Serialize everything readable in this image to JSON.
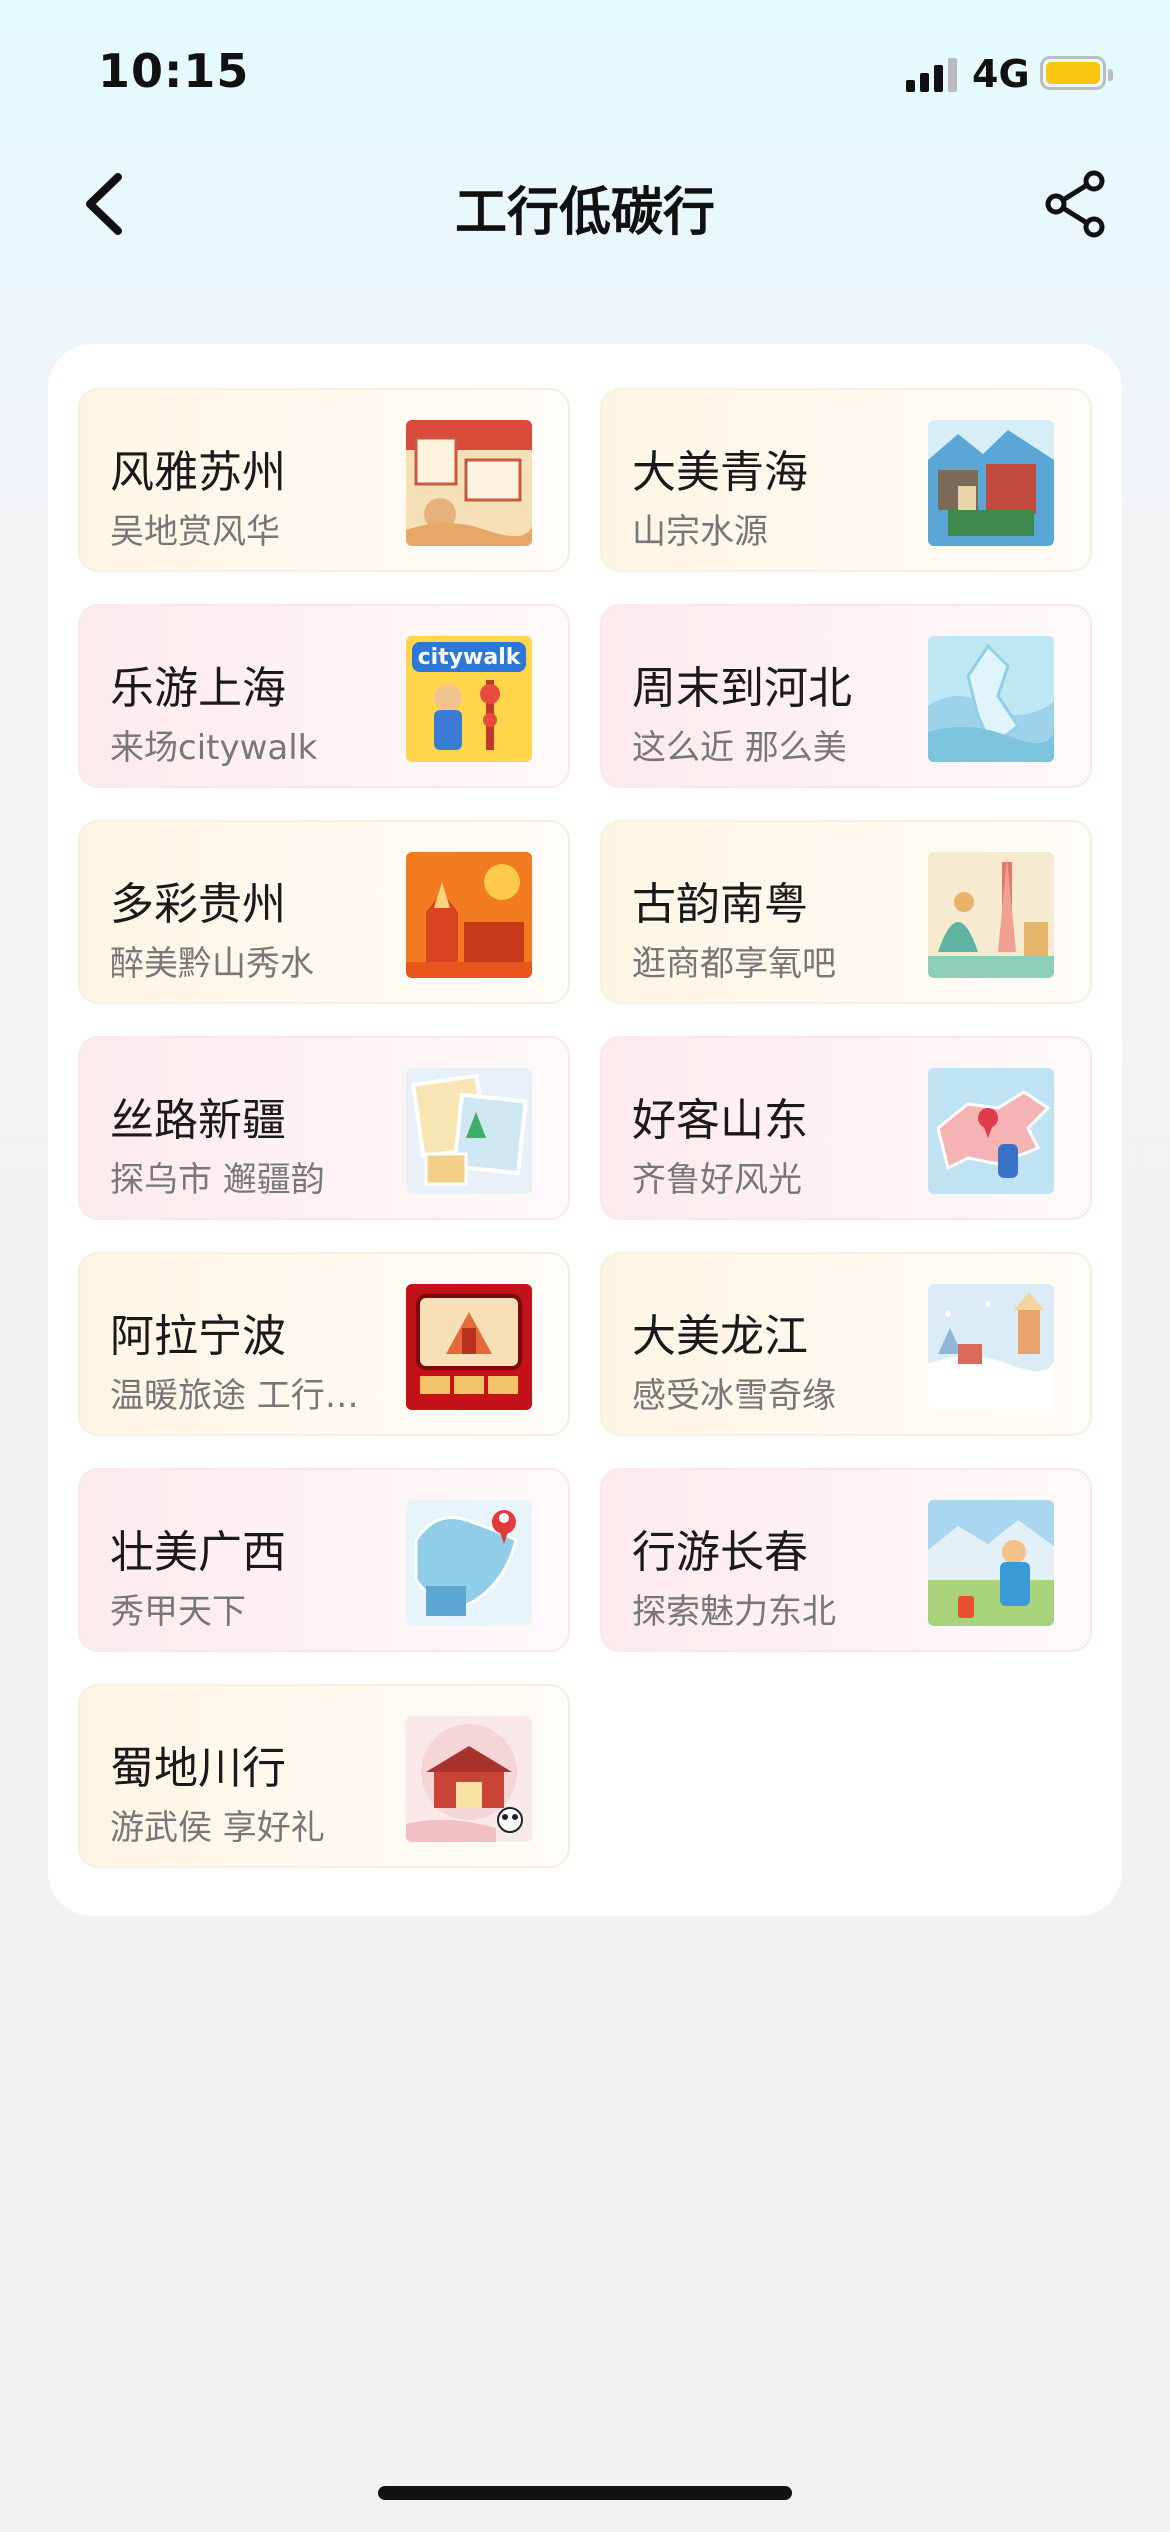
{
  "status": {
    "time": "10:15",
    "network": "4G"
  },
  "nav": {
    "title": "工行低碳行"
  },
  "tiles": [
    {
      "title": "风雅苏州",
      "subtitle": "吴地赏风华",
      "style": "warm",
      "thumb": "suzhou",
      "icon": "suzhou-thumbnail"
    },
    {
      "title": "大美青海",
      "subtitle": "山宗水源",
      "style": "warm",
      "thumb": "qinghai",
      "icon": "qinghai-thumbnail"
    },
    {
      "title": "乐游上海",
      "subtitle": "来场citywalk",
      "style": "pink",
      "thumb": "shanghai",
      "icon": "shanghai-thumbnail",
      "thumb_text": "citywalk"
    },
    {
      "title": "周末到河北",
      "subtitle": "这么近 那么美",
      "style": "pink",
      "thumb": "hebei",
      "icon": "hebei-thumbnail"
    },
    {
      "title": "多彩贵州",
      "subtitle": "醉美黔山秀水",
      "style": "warm",
      "thumb": "guizhou",
      "icon": "guizhou-thumbnail"
    },
    {
      "title": "古韵南粤",
      "subtitle": "逛商都享氧吧",
      "style": "warm",
      "thumb": "nanyue",
      "icon": "nanyue-thumbnail"
    },
    {
      "title": "丝路新疆",
      "subtitle": "探乌市 邂疆韵",
      "style": "pink",
      "thumb": "xinjiang",
      "icon": "xinjiang-thumbnail"
    },
    {
      "title": "好客山东",
      "subtitle": "齐鲁好风光",
      "style": "pink",
      "thumb": "shandong",
      "icon": "shandong-thumbnail"
    },
    {
      "title": "阿拉宁波",
      "subtitle": "温暖旅途 工行…",
      "style": "warm",
      "thumb": "ningbo",
      "icon": "ningbo-thumbnail"
    },
    {
      "title": "大美龙江",
      "subtitle": "感受冰雪奇缘",
      "style": "warm",
      "thumb": "longjiang",
      "icon": "longjiang-thumbnail"
    },
    {
      "title": "壮美广西",
      "subtitle": "秀甲天下",
      "style": "pink",
      "thumb": "guangxi",
      "icon": "guangxi-thumbnail"
    },
    {
      "title": "行游长春",
      "subtitle": "探索魅力东北",
      "style": "pink",
      "thumb": "changchun",
      "icon": "changchun-thumbnail"
    },
    {
      "title": "蜀地川行",
      "subtitle": "游武侯 享好礼",
      "style": "warm",
      "thumb": "sichuan",
      "icon": "sichuan-thumbnail"
    }
  ],
  "colors": {
    "accent_yellow": "#f9c80e",
    "warm_tile": "#fdf5e4",
    "pink_tile": "#fdebee"
  }
}
